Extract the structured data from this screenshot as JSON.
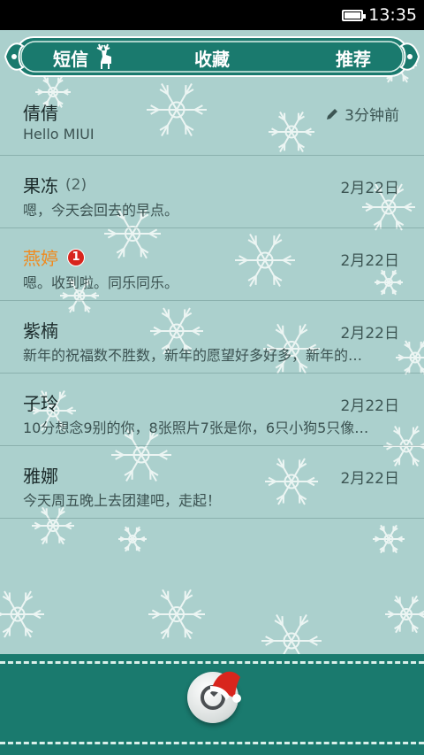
{
  "status_bar": {
    "time": "13:35"
  },
  "tabs": [
    {
      "label": "短信",
      "active": true
    },
    {
      "label": "收藏",
      "active": false
    },
    {
      "label": "推荐",
      "active": false
    }
  ],
  "conversations": [
    {
      "name": "倩倩",
      "count": "",
      "badge": "",
      "time": "3分钟前",
      "snippet": "Hello MIUI",
      "draft": true,
      "unread": false
    },
    {
      "name": "果冻",
      "count": "(2)",
      "badge": "",
      "time": "2月22日",
      "snippet": "嗯，今天会回去的早点。",
      "draft": false,
      "unread": false
    },
    {
      "name": "燕婷",
      "count": "",
      "badge": "1",
      "time": "2月22日",
      "snippet": "嗯。收到啦。同乐同乐。",
      "draft": false,
      "unread": true
    },
    {
      "name": "紫楠",
      "count": "",
      "badge": "",
      "time": "2月22日",
      "snippet": "新年的祝福数不胜数，新年的愿望好多好多，新年的…",
      "draft": false,
      "unread": false
    },
    {
      "name": "子玲",
      "count": "",
      "badge": "",
      "time": "2月22日",
      "snippet": "10分想念9别的你，8张照片7张是你，6只小狗5只像…",
      "draft": false,
      "unread": false
    },
    {
      "name": "雅娜",
      "count": "",
      "badge": "",
      "time": "2月22日",
      "snippet": "今天周五晚上去团建吧，走起！",
      "draft": false,
      "unread": false
    }
  ],
  "icons": {
    "battery": "battery-icon",
    "deer": "reindeer-icon",
    "draft": "pencil-icon",
    "compose": "compose-icon",
    "hat": "santa-hat-icon"
  },
  "colors": {
    "background": "#abd0cd",
    "header": "#1a7a6e",
    "unread_name": "#f08a1e",
    "badge": "#d8251d"
  }
}
